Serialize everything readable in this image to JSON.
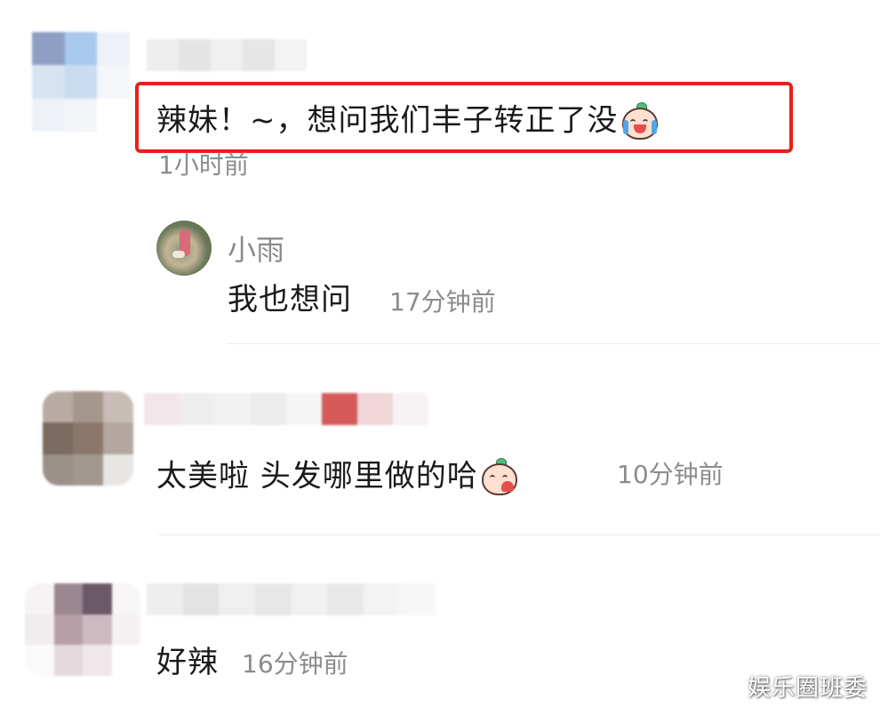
{
  "comments": [
    {
      "text": "辣妹！~，想问我们丰子转正了没",
      "time": "1小时前",
      "emoji": "crying-laugh-peach-emoji",
      "highlighted": true,
      "reply": {
        "username": "小雨",
        "text": "我也想问",
        "time": "17分钟前"
      }
    },
    {
      "text": "太美啦 头发哪里做的哈",
      "time": "10分钟前",
      "emoji": "heart-peach-emoji"
    },
    {
      "text": "好辣",
      "time": "16分钟前"
    }
  ],
  "colors": {
    "highlight_border": "#e8201a",
    "meta_text": "#8c8c8c",
    "divider": "#ececec"
  },
  "watermark": "娱乐圈班委"
}
